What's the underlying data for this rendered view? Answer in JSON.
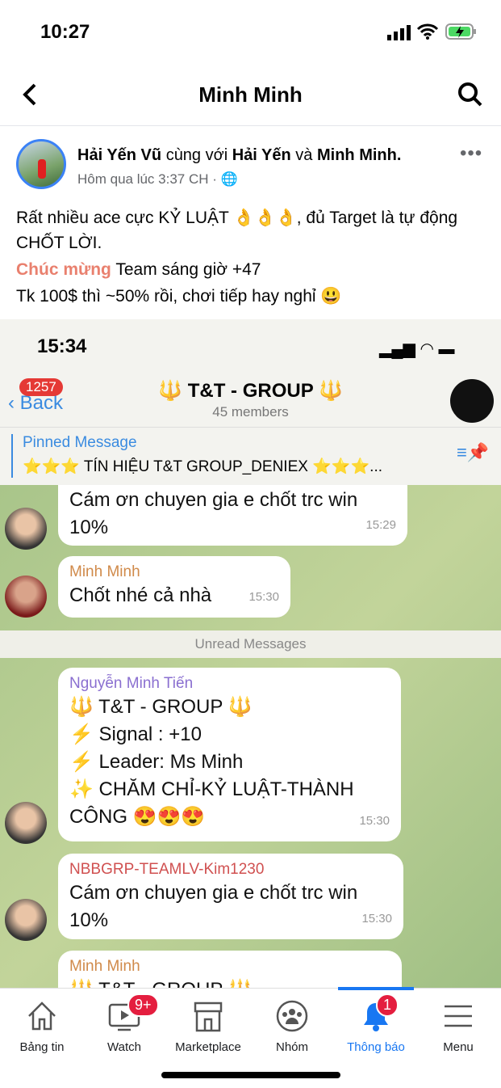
{
  "status_bar": {
    "time": "10:27"
  },
  "nav": {
    "title": "Minh Minh"
  },
  "post": {
    "author": "Hải Yến Vũ",
    "with_word": "cùng với",
    "tagged1": "Hải Yến",
    "and_word": "và",
    "tagged2": "Minh Minh.",
    "timestamp": "Hôm qua lúc 3:37 CH ·",
    "line1": "Rất nhiều ace cực KỶ LUẬT 👌👌👌, đủ Target là tự động CHỐT LỜI.",
    "highlight": "Chúc mừng",
    "line2_rest": " Team sáng giờ +47",
    "line3": "Tk 100$ thì ~50% rồi, chơi tiếp hay nghỉ 😃"
  },
  "telegram": {
    "time": "15:34",
    "back_badge": "1257",
    "back_label": "Back",
    "group_title": "🔱 T&T - GROUP 🔱",
    "members": "45 members",
    "pinned_label": "Pinned Message",
    "pinned_text": "⭐⭐⭐ TÍN HIỆU T&T GROUP_DENIEX ⭐⭐⭐...",
    "unread_label": "Unread Messages",
    "messages": [
      {
        "text": "Cám ơn chuyen gia e chốt trc  win 10%",
        "time": "15:29"
      },
      {
        "sender": "Minh Minh",
        "text": "Chốt nhé cả nhà",
        "time": "15:30"
      },
      {
        "sender": "Nguyễn Minh Tiến",
        "lines": [
          "🔱 T&T - GROUP 🔱",
          "⚡ Signal :  +10",
          "⚡ Leader:  Ms Minh",
          "✨ CHĂM CHỈ-KỶ LUẬT-THÀNH CÔNG 😍😍😍"
        ],
        "time": "15:30"
      },
      {
        "sender": "NBBGRP-TEAMLV-Kim1230",
        "text": "Cám ơn chuyen gia e chốt trc  win 10%",
        "time": "15:30"
      },
      {
        "sender": "Minh Minh",
        "text": "🔱 T&T - GROUP 🔱"
      }
    ]
  },
  "bottom_nav": [
    {
      "label": "Bảng tin",
      "icon": "home-icon"
    },
    {
      "label": "Watch",
      "icon": "watch-icon",
      "badge": "9+"
    },
    {
      "label": "Marketplace",
      "icon": "marketplace-icon"
    },
    {
      "label": "Nhóm",
      "icon": "groups-icon"
    },
    {
      "label": "Thông báo",
      "icon": "bell-icon",
      "badge": "1",
      "active": true
    },
    {
      "label": "Menu",
      "icon": "menu-icon"
    }
  ],
  "colors": {
    "accent": "#1877f2",
    "badge": "#e41e3f",
    "highlight": "#e9806e",
    "telegram_link": "#3a8be0"
  }
}
